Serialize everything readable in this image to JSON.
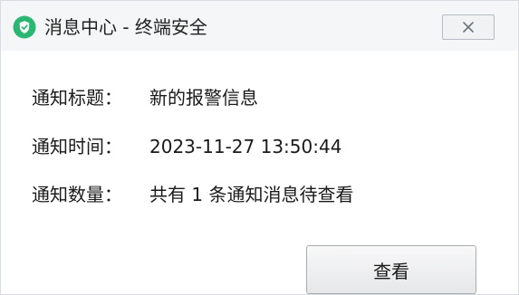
{
  "window": {
    "title": "消息中心 - 终端安全",
    "app_icon": "shield-check-icon",
    "close_icon": "close-icon",
    "accent_color": "#2bb673"
  },
  "fields": [
    {
      "label": "通知标题：",
      "value": "新的报警信息"
    },
    {
      "label": "通知时间：",
      "value": "2023-11-27 13:50:44"
    },
    {
      "label": "通知数量：",
      "value": "共有 1 条通知消息待查看"
    }
  ],
  "actions": {
    "view_label": "查看"
  }
}
